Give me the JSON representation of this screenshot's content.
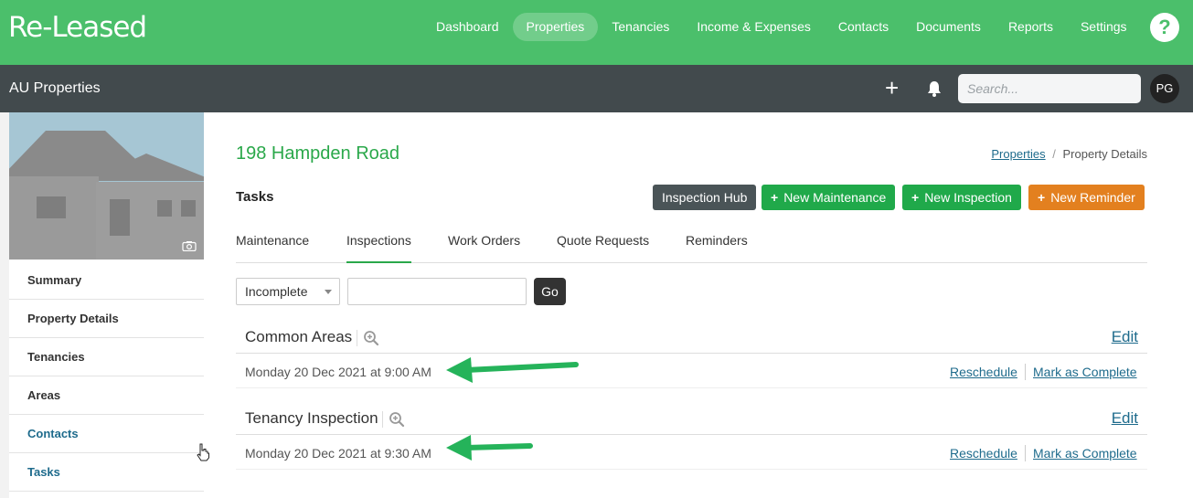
{
  "app": {
    "logo": "Re-Leased",
    "help_label": "?"
  },
  "nav": {
    "items": [
      {
        "label": "Dashboard",
        "active": false
      },
      {
        "label": "Properties",
        "active": true
      },
      {
        "label": "Tenancies",
        "active": false
      },
      {
        "label": "Income & Expenses",
        "active": false
      },
      {
        "label": "Contacts",
        "active": false
      },
      {
        "label": "Documents",
        "active": false
      },
      {
        "label": "Reports",
        "active": false
      },
      {
        "label": "Settings",
        "active": false
      }
    ]
  },
  "subbar": {
    "title": "AU Properties",
    "add_label": "+",
    "search_placeholder": "Search...",
    "avatar_initials": "PG"
  },
  "sidebar": {
    "items": [
      {
        "label": "Summary"
      },
      {
        "label": "Property Details"
      },
      {
        "label": "Tenancies"
      },
      {
        "label": "Areas"
      },
      {
        "label": "Contacts"
      },
      {
        "label": "Tasks"
      }
    ]
  },
  "page": {
    "title": "198 Hampden Road",
    "breadcrumb": {
      "link": "Properties",
      "separator": "/",
      "current": "Property Details"
    },
    "section_heading": "Tasks"
  },
  "buttons": {
    "inspection_hub": "Inspection Hub",
    "new_maintenance": "New Maintenance",
    "new_inspection": "New Inspection",
    "new_reminder": "New Reminder",
    "plus_glyph": "+"
  },
  "tabs": [
    {
      "label": "Maintenance",
      "active": false
    },
    {
      "label": "Inspections",
      "active": true
    },
    {
      "label": "Work Orders",
      "active": false
    },
    {
      "label": "Quote Requests",
      "active": false
    },
    {
      "label": "Reminders",
      "active": false
    }
  ],
  "filter": {
    "status_value": "Incomplete",
    "text_value": "",
    "go_label": "Go"
  },
  "inspections": [
    {
      "name": "Common Areas",
      "edit_label": "Edit",
      "datetime": "Monday 20 Dec 2021 at 9:00 AM",
      "reschedule_label": "Reschedule",
      "complete_label": "Mark as Complete"
    },
    {
      "name": "Tenancy Inspection",
      "edit_label": "Edit",
      "datetime": "Monday 20 Dec 2021 at 9:30 AM",
      "reschedule_label": "Reschedule",
      "complete_label": "Mark as Complete"
    }
  ],
  "colors": {
    "brand_green": "#4bbf6b",
    "title_green": "#2aa84a",
    "subbar_bg": "#424a4d",
    "link_blue": "#1e6b8c",
    "reminder_orange": "#e3801f",
    "annotation_arrow": "#25b35a"
  }
}
